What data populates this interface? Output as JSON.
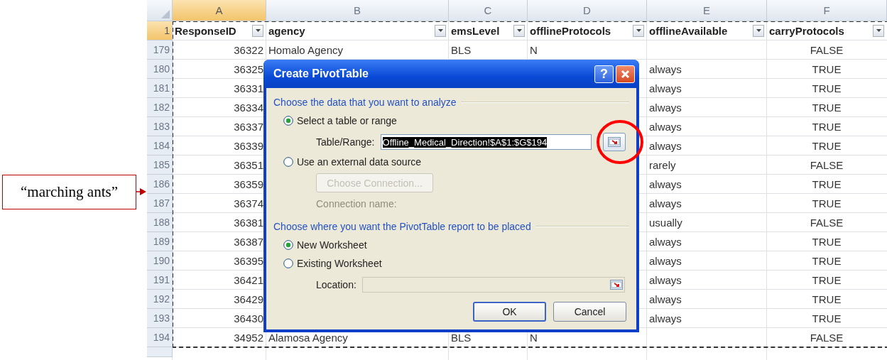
{
  "annotation": {
    "text": "“marching ants”"
  },
  "sheet": {
    "columns": [
      {
        "letter": "A",
        "selected": true
      },
      {
        "letter": "B",
        "selected": false
      },
      {
        "letter": "C",
        "selected": false
      },
      {
        "letter": "D",
        "selected": false
      },
      {
        "letter": "E",
        "selected": false
      },
      {
        "letter": "F",
        "selected": false
      }
    ],
    "header_row": {
      "number": "1",
      "selected": true,
      "cells": [
        "ResponseID",
        "agency",
        "emsLevel",
        "offlineProtocols",
        "offlineAvailable",
        "carryProtocols"
      ]
    },
    "rows": [
      {
        "number": "179",
        "cells": {
          "A": "36322",
          "B": "Homalo Agency",
          "C": "BLS",
          "D": "N",
          "F": "FALSE"
        }
      },
      {
        "number": "180",
        "cells": {
          "A": "36325",
          "E": "always",
          "F": "TRUE"
        }
      },
      {
        "number": "181",
        "cells": {
          "A": "36331",
          "E": "always",
          "F": "TRUE"
        }
      },
      {
        "number": "182",
        "cells": {
          "A": "36334",
          "E": "always",
          "F": "TRUE"
        }
      },
      {
        "number": "183",
        "cells": {
          "A": "36337",
          "E": "always",
          "F": "TRUE"
        }
      },
      {
        "number": "184",
        "cells": {
          "A": "36339",
          "E": "always",
          "F": "TRUE"
        }
      },
      {
        "number": "185",
        "cells": {
          "A": "36351",
          "E": "rarely",
          "F": "FALSE"
        }
      },
      {
        "number": "186",
        "cells": {
          "A": "36359",
          "E": "always",
          "F": "TRUE"
        }
      },
      {
        "number": "187",
        "cells": {
          "A": "36374",
          "E": "always",
          "F": "TRUE"
        }
      },
      {
        "number": "188",
        "cells": {
          "A": "36381",
          "E": "usually",
          "F": "FALSE"
        }
      },
      {
        "number": "189",
        "cells": {
          "A": "36387",
          "E": "always",
          "F": "TRUE"
        }
      },
      {
        "number": "190",
        "cells": {
          "A": "36395",
          "E": "always",
          "F": "TRUE"
        }
      },
      {
        "number": "191",
        "cells": {
          "A": "36421",
          "E": "always",
          "F": "TRUE"
        }
      },
      {
        "number": "192",
        "cells": {
          "A": "36429",
          "E": "always",
          "F": "TRUE"
        }
      },
      {
        "number": "193",
        "cells": {
          "A": "36430",
          "E": "always",
          "F": "TRUE"
        }
      },
      {
        "number": "194",
        "cells": {
          "A": "34952",
          "B": "Alamosa Agency",
          "C": "BLS",
          "D": "N",
          "F": "FALSE"
        }
      }
    ]
  },
  "dialog": {
    "title": "Create PivotTable",
    "help_button": "?",
    "sections": [
      {
        "heading": "Choose the data that you want to analyze",
        "options": [
          {
            "label": "Select a table or range",
            "selected": true,
            "field": {
              "label": "Table/Range:",
              "value": "Offline_Medical_Direction!$A$1:$G$194",
              "highlighted": true,
              "disabled": false
            }
          },
          {
            "label": "Use an external data source",
            "selected": false,
            "button": {
              "label": "Choose Connection...",
              "disabled": true
            },
            "note": {
              "text": "Connection name:",
              "disabled": true
            }
          }
        ]
      },
      {
        "heading": "Choose where you want the PivotTable report to be placed",
        "options": [
          {
            "label": "New Worksheet",
            "selected": true
          },
          {
            "label": "Existing Worksheet",
            "selected": false,
            "field": {
              "label": "Location:",
              "disabled": true
            }
          }
        ]
      }
    ],
    "buttons": [
      {
        "label": "OK",
        "default": true
      },
      {
        "label": "Cancel",
        "default": false
      }
    ]
  }
}
